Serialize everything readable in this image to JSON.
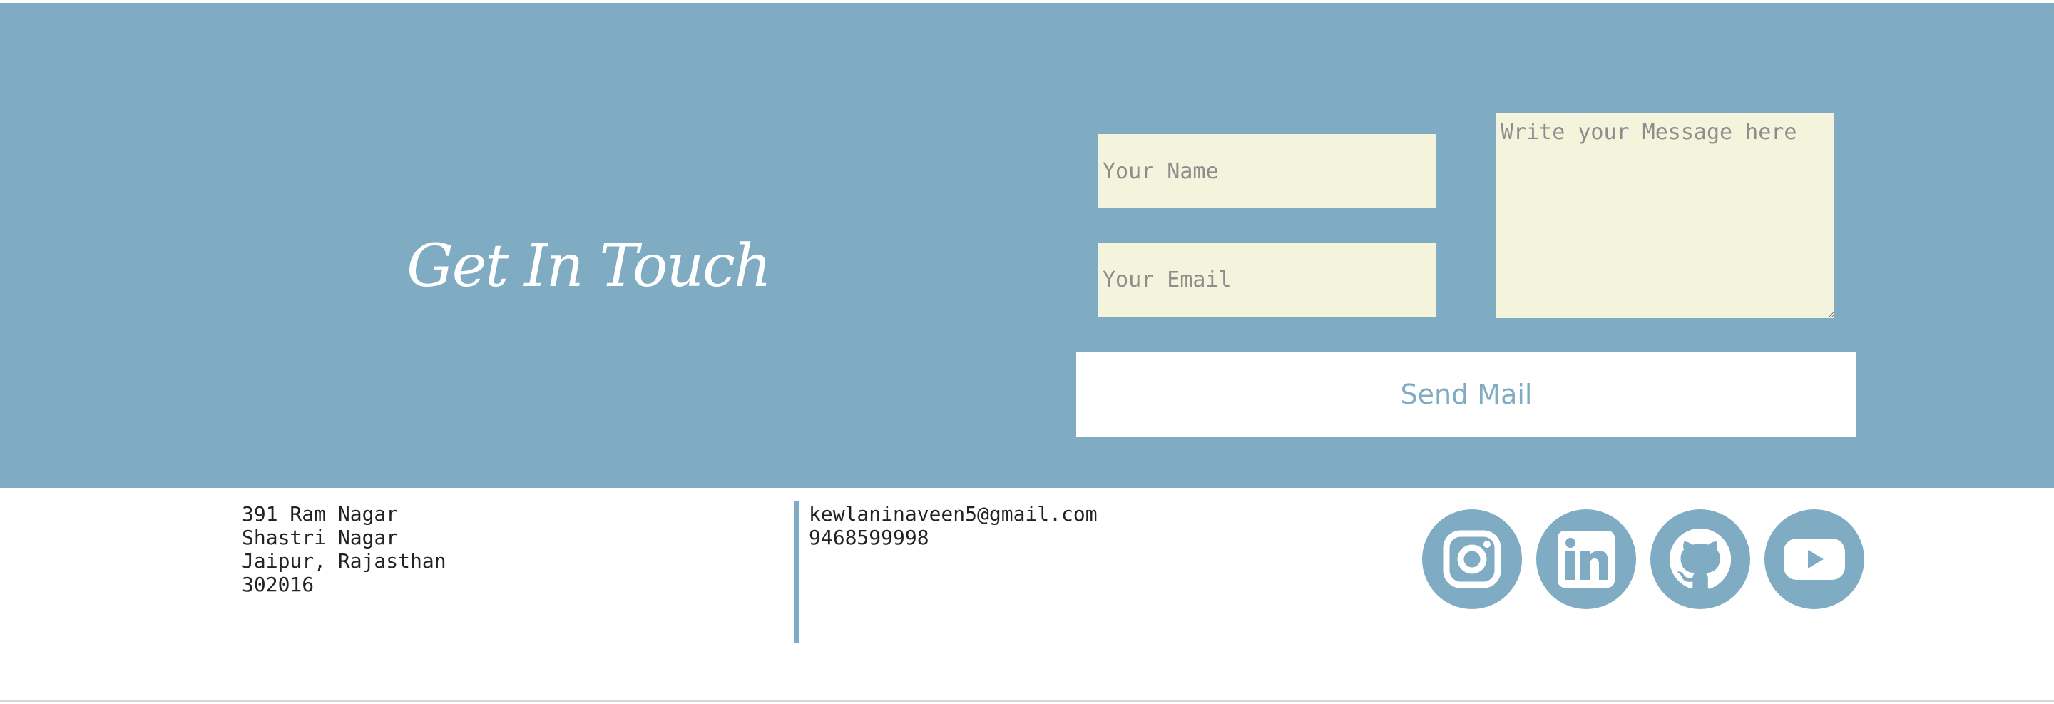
{
  "contact_section": {
    "heading": "Get In Touch",
    "form": {
      "name_placeholder": "Your Name",
      "email_placeholder": "Your Email",
      "message_placeholder": "Write your Message here",
      "submit_label": "Send Mail"
    }
  },
  "footer": {
    "address": [
      "391 Ram Nagar",
      "Shastri Nagar",
      "Jaipur, Rajasthan",
      "302016"
    ],
    "email": "kewlaninaveen5@gmail.com",
    "phone": "9468599998",
    "social_icons": [
      "instagram-icon",
      "linkedin-icon",
      "github-icon",
      "youtube-icon"
    ]
  },
  "colors": {
    "accent": "#7facc3",
    "input_bg": "#f4f3dc",
    "heading_text": "#ffffff"
  }
}
